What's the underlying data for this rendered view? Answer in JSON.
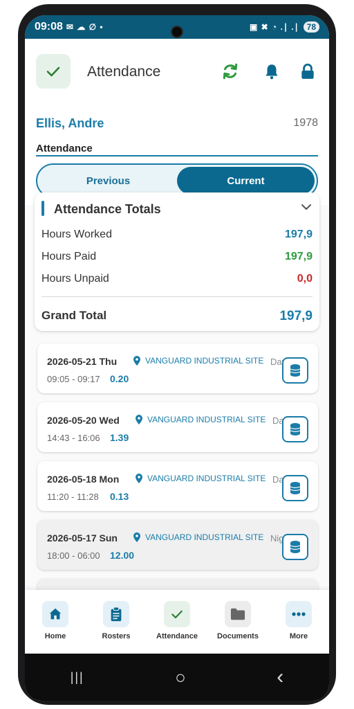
{
  "status_bar": {
    "time": "09:08",
    "left_glyphs": "✉ ☁ ∅ •",
    "right_glyphs": "▣ ✖ ◔ .∣ .∣",
    "battery": "78"
  },
  "header": {
    "title": "Attendance"
  },
  "user": {
    "name": "Ellis, Andre",
    "id": "1978"
  },
  "section": {
    "label": "Attendance"
  },
  "segments": {
    "previous": "Previous",
    "current": "Current",
    "selected": "Current"
  },
  "totals": {
    "title": "Attendance Totals",
    "rows": [
      {
        "label": "Hours Worked",
        "value": "197,9",
        "color": "#1a7ca8"
      },
      {
        "label": "Hours Paid",
        "value": "197,9",
        "color": "#2e9b3e"
      },
      {
        "label": "Hours Unpaid",
        "value": "0,0",
        "color": "#c62828"
      }
    ],
    "grand_label": "Grand Total",
    "grand_value": "197,9"
  },
  "shifts": [
    {
      "date": "2026-05-21 Thu",
      "site": "VANGUARD INDUSTRIAL SITE",
      "period": "Day",
      "time": "09:05 - 09:17",
      "hours": "0.20"
    },
    {
      "date": "2026-05-20 Wed",
      "site": "VANGUARD INDUSTRIAL SITE",
      "period": "Day",
      "time": "14:43 - 16:06",
      "hours": "1.39"
    },
    {
      "date": "2026-05-18 Mon",
      "site": "VANGUARD INDUSTRIAL SITE",
      "period": "Day",
      "time": "11:20 - 11:28",
      "hours": "0.13"
    },
    {
      "date": "2026-05-17 Sun",
      "site": "VANGUARD INDUSTRIAL SITE",
      "period": "Night",
      "time": "18:00 - 06:00",
      "hours": "12.00"
    }
  ],
  "bottom_nav": [
    {
      "label": "Home",
      "icon": "home-icon"
    },
    {
      "label": "Rosters",
      "icon": "clipboard-icon"
    },
    {
      "label": "Attendance",
      "icon": "check-icon"
    },
    {
      "label": "Documents",
      "icon": "folder-icon"
    },
    {
      "label": "More",
      "icon": "more-icon"
    }
  ],
  "system_nav": {
    "recents": "|||",
    "home": "○",
    "back": "‹"
  },
  "colors": {
    "brand": "#1a7ca8",
    "status_bar": "#0b5a7a",
    "accent_green": "#2e9b3e"
  }
}
